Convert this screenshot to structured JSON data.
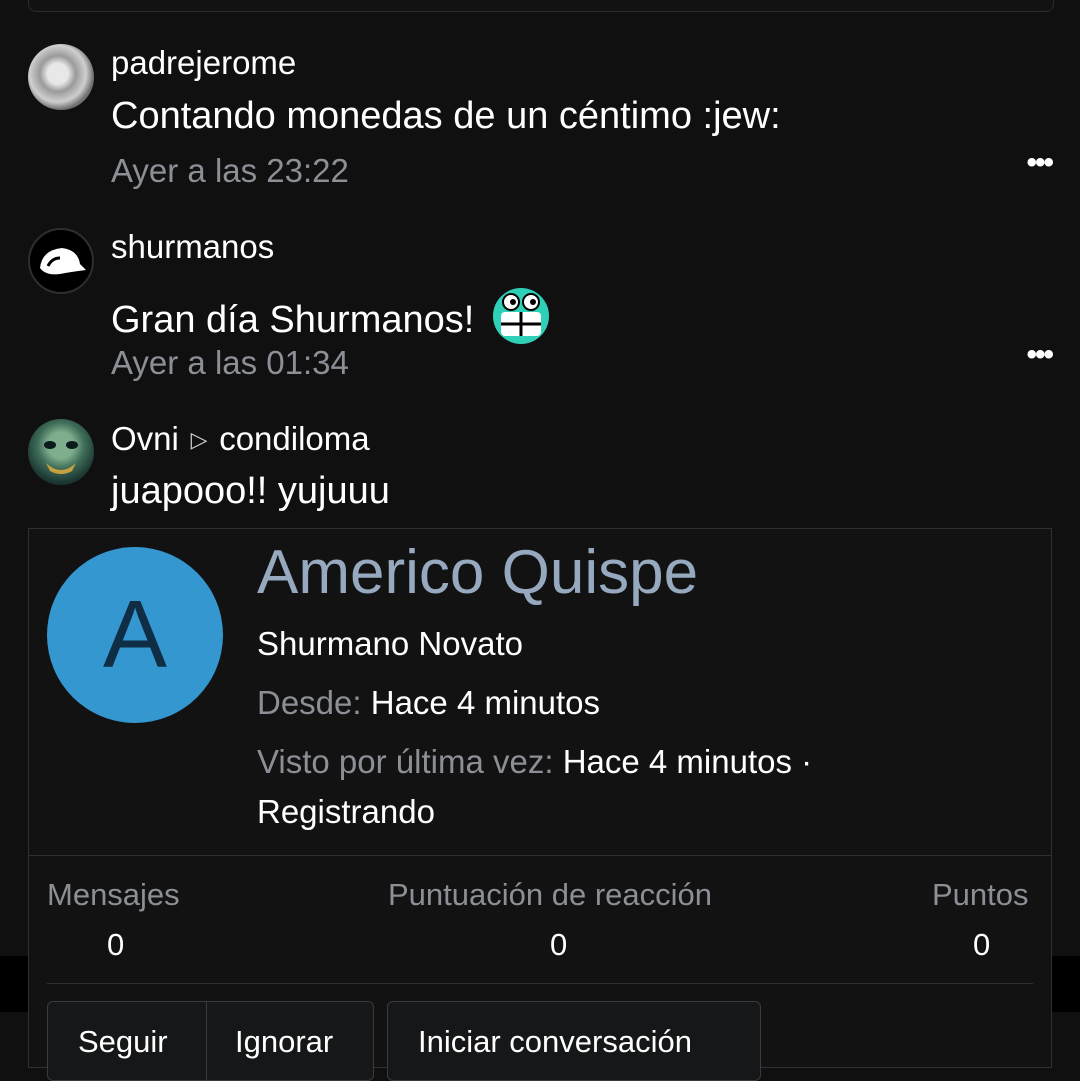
{
  "posts": [
    {
      "username": "padrejerome",
      "content": "Contando monedas de un céntimo :jew:",
      "time": "Ayer a las 23:22",
      "more": "•••"
    },
    {
      "username": "shurmanos",
      "content": "Gran día Shurmanos!",
      "time": "Ayer a las 01:34",
      "more": "•••"
    },
    {
      "username": "Ovni",
      "target": "condiloma",
      "content": "juapooo!! yujuuu"
    }
  ],
  "profile": {
    "avatar_letter": "A",
    "avatar_color": "#3597d0",
    "name": "Americo Quispe",
    "title": "Shurmano Novato",
    "since_label": "Desde:",
    "since_value": "Hace 4 minutos",
    "seen_label": "Visto por última vez:",
    "seen_value": "Hace 4 minutos ·",
    "seen_activity": "Registrando",
    "stats": [
      {
        "label": "Mensajes",
        "value": "0"
      },
      {
        "label": "Puntuación de reacción",
        "value": "0"
      },
      {
        "label": "Puntos",
        "value": "0"
      }
    ],
    "buttons": {
      "follow": "Seguir",
      "ignore": "Ignorar",
      "conversation": "Iniciar conversación"
    }
  }
}
